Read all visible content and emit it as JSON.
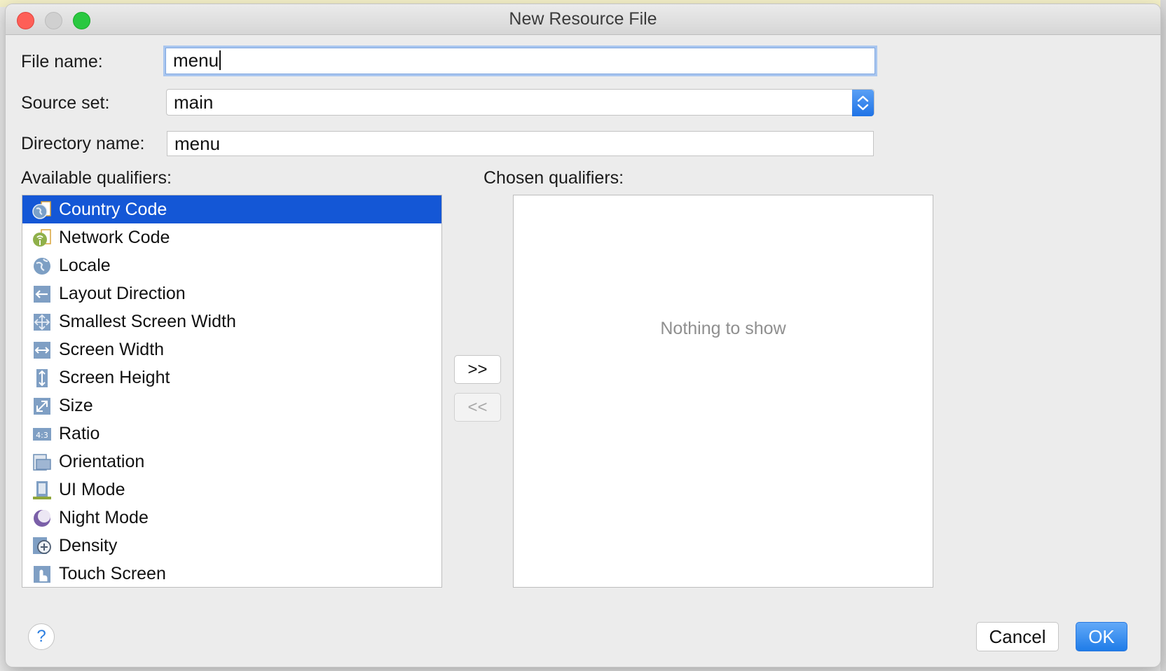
{
  "window": {
    "title": "New Resource File"
  },
  "form": {
    "file_name_label": "File name:",
    "file_name_value": "menu",
    "source_set_label": "Source set:",
    "source_set_value": "main",
    "directory_name_label": "Directory name:",
    "directory_name_value": "menu"
  },
  "qualifiers": {
    "available_label": "Available qualifiers:",
    "chosen_label": "Chosen qualifiers:",
    "empty_text": "Nothing to show",
    "items": [
      {
        "label": "Country Code",
        "icon": "country-code-icon",
        "selected": true
      },
      {
        "label": "Network Code",
        "icon": "network-code-icon",
        "selected": false
      },
      {
        "label": "Locale",
        "icon": "globe-icon",
        "selected": false
      },
      {
        "label": "Layout Direction",
        "icon": "layout-direction-icon",
        "selected": false
      },
      {
        "label": "Smallest Screen Width",
        "icon": "smallest-screen-width-icon",
        "selected": false
      },
      {
        "label": "Screen Width",
        "icon": "screen-width-icon",
        "selected": false
      },
      {
        "label": "Screen Height",
        "icon": "screen-height-icon",
        "selected": false
      },
      {
        "label": "Size",
        "icon": "size-icon",
        "selected": false
      },
      {
        "label": "Ratio",
        "icon": "ratio-icon",
        "selected": false
      },
      {
        "label": "Orientation",
        "icon": "orientation-icon",
        "selected": false
      },
      {
        "label": "UI Mode",
        "icon": "ui-mode-icon",
        "selected": false
      },
      {
        "label": "Night Mode",
        "icon": "night-mode-icon",
        "selected": false
      },
      {
        "label": "Density",
        "icon": "density-icon",
        "selected": false
      },
      {
        "label": "Touch Screen",
        "icon": "touch-screen-icon",
        "selected": false
      }
    ]
  },
  "buttons": {
    "add": ">>",
    "remove": "<<",
    "cancel": "Cancel",
    "ok": "OK",
    "help": "?"
  },
  "colors": {
    "selection": "#1457d6",
    "primary_button": "#1f7ce8",
    "focus_ring": "#a9c6ef"
  }
}
